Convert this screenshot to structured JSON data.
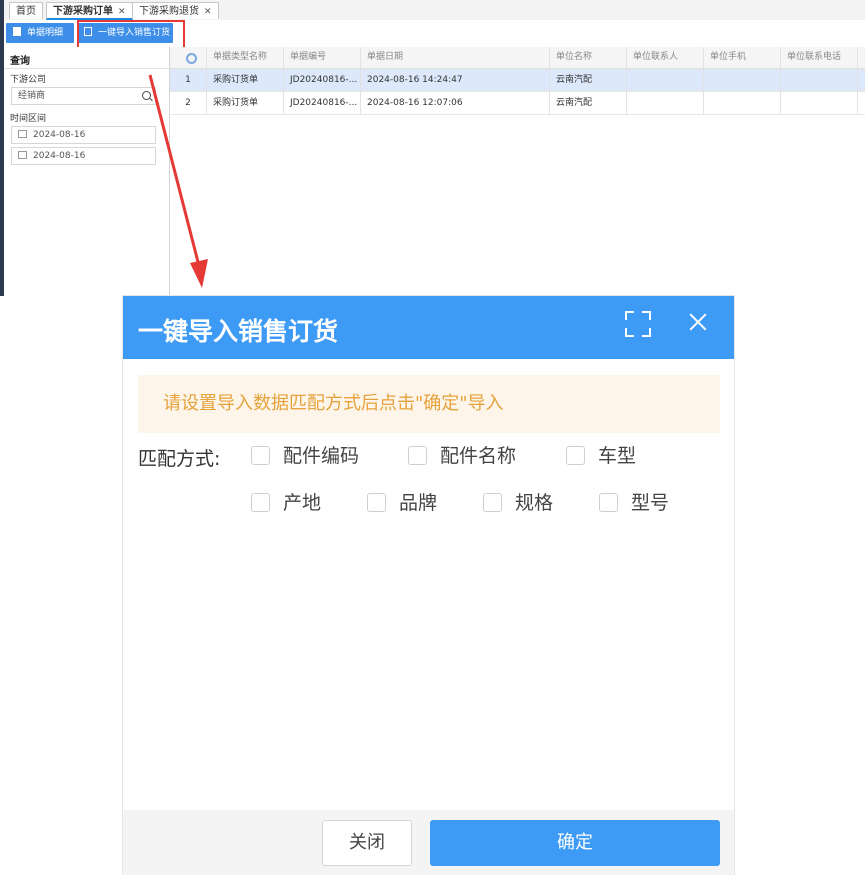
{
  "tabs": [
    {
      "label": "首页",
      "closable": false
    },
    {
      "label": "下游采购订单",
      "closable": true,
      "active": true
    },
    {
      "label": "下游采购退货",
      "closable": true
    }
  ],
  "tab_close_glyph": "✕",
  "toolbar": {
    "detail_button": "单据明细",
    "import_button": "一键导入销售订货"
  },
  "query_panel": {
    "title": "查询",
    "company_label": "下游公司",
    "company_placeholder": "经销商",
    "date_range_label": "时间区间",
    "date_start": "2024-08-16",
    "date_end": "2024-08-16"
  },
  "grid": {
    "columns": [
      "单据类型名称",
      "单据编号",
      "单据日期",
      "单位名称",
      "单位联系人",
      "单位手机",
      "单位联系电话"
    ],
    "rows": [
      {
        "num": "1",
        "type": "采购订货单",
        "code": "JD20240816-...",
        "date": "2024-08-16 14:24:47",
        "unit": "云南汽配",
        "contact": "",
        "mobile": "",
        "phone": ""
      },
      {
        "num": "2",
        "type": "采购订货单",
        "code": "JD20240816-...",
        "date": "2024-08-16 12:07:06",
        "unit": "云南汽配",
        "contact": "",
        "mobile": "",
        "phone": ""
      }
    ]
  },
  "modal": {
    "title": "一键导入销售订货",
    "notice": "请设置导入数据匹配方式后点击\"确定\"导入",
    "match_label": "匹配方式:",
    "options": [
      {
        "label": "配件编码",
        "checked": false
      },
      {
        "label": "配件名称",
        "checked": false
      },
      {
        "label": "车型",
        "checked": false
      },
      {
        "label": "产地",
        "checked": false
      },
      {
        "label": "品牌",
        "checked": false
      },
      {
        "label": "规格",
        "checked": false
      },
      {
        "label": "型号",
        "checked": false
      }
    ],
    "close_button": "关闭",
    "confirm_button": "确定"
  },
  "colors": {
    "primary": "#3d9bf5",
    "toolbar_button": "#3d8ee8",
    "notice_bg": "#fdf5e9",
    "notice_text": "#e6a23c",
    "highlight": "#e53935",
    "selected_row": "#dde9fb"
  }
}
